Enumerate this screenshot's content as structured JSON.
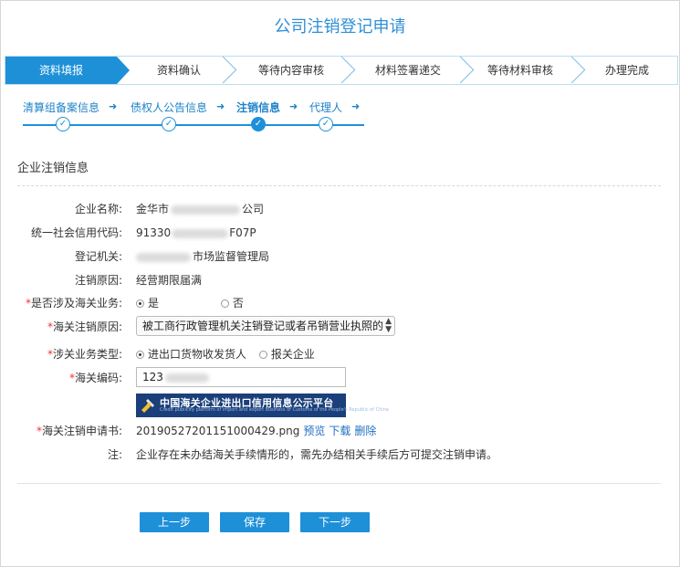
{
  "page": {
    "title": "公司注销登记申请"
  },
  "progress": {
    "steps": [
      "资料填报",
      "资料确认",
      "等待内容审核",
      "材料签署递交",
      "等待材料审核",
      "办理完成"
    ]
  },
  "substeps": [
    "清算组备案信息",
    "债权人公告信息",
    "注销信息",
    "代理人"
  ],
  "section": {
    "title": "企业注销信息"
  },
  "form": {
    "company_name": {
      "label": "企业名称:",
      "prefix": "金华市",
      "suffix": "公司"
    },
    "credit_code": {
      "label": "统一社会信用代码:",
      "prefix": "91330",
      "suffix": "F07P"
    },
    "reg_authority": {
      "label": "登记机关:",
      "suffix": "市场监督管理局"
    },
    "reason": {
      "label": "注销原因:",
      "value": "经营期限届满"
    },
    "customs_involved": {
      "label": "是否涉及海关业务:",
      "required_mark": "*",
      "options": [
        "是",
        "否"
      ],
      "selected": "是"
    },
    "customs_reason": {
      "label": "海关注销原因:",
      "required_mark": "*",
      "value": "被工商行政管理机关注销登记或者吊销营业执照的"
    },
    "business_type": {
      "label": "涉关业务类型:",
      "required_mark": "*",
      "options": [
        "进出口货物收发货人",
        "报关企业"
      ],
      "selected": "进出口货物收发货人"
    },
    "customs_code": {
      "label": "海关编码:",
      "required_mark": "*",
      "value": "123"
    },
    "banner": {
      "title": "中国海关企业进出口信用信息公示平台",
      "subtitle": "Credit publicity platform of import and export business of Customs of the People's Republic of China"
    },
    "application": {
      "label": "海关注销申请书:",
      "required_mark": "*",
      "filename": "20190527201151000429.png",
      "preview": "预览",
      "download": "下载",
      "delete": "删除"
    },
    "note": {
      "label": "注:",
      "value": "企业存在未办结海关手续情形的，需先办结相关手续后方可提交注销申请。"
    }
  },
  "buttons": {
    "prev": "上一步",
    "save": "保存",
    "next": "下一步"
  },
  "colors": {
    "accent": "#1e90d8",
    "title": "#2f8fd6",
    "required": "#e33333",
    "banner": "#1a3f7a"
  }
}
